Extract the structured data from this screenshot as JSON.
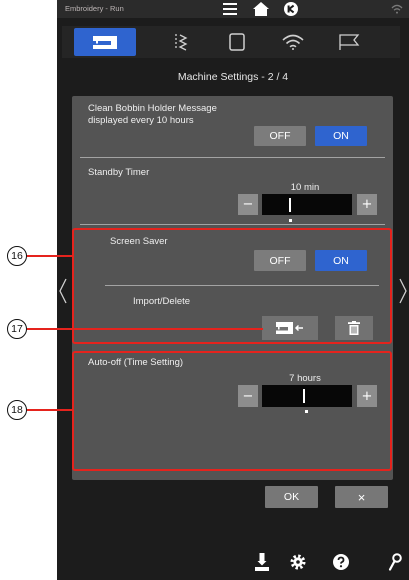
{
  "colors": {
    "accent_blue": "#2f64cf",
    "callout_red": "#e5231d",
    "screen_bg": "#1c1c1c",
    "panel_bg": "#545454",
    "button_gray": "#7c7c7c"
  },
  "status_bar": {
    "title": "Embroidery - Run",
    "icons": [
      "menu-icon",
      "home-icon",
      "circle-k-icon",
      "wifi-icon"
    ]
  },
  "tabs": [
    {
      "icon": "sewing-machine-icon",
      "selected": true
    },
    {
      "icon": "stitch-pattern-icon",
      "selected": false
    },
    {
      "icon": "embroidery-frame-icon",
      "selected": false
    },
    {
      "icon": "wifi-icon",
      "selected": false
    },
    {
      "icon": "flag-icon",
      "selected": false
    }
  ],
  "page_title": "Machine Settings - 2 / 4",
  "settings": {
    "bobbin_message": {
      "label_line1": "Clean Bobbin Holder Message",
      "label_line2": "displayed every 10 hours",
      "off_label": "OFF",
      "on_label": "ON",
      "on_selected": true
    },
    "standby_timer": {
      "label": "Standby Timer",
      "value": "10 min",
      "minus_label": "−",
      "plus_label": "+"
    },
    "screen_saver": {
      "label": "Screen Saver",
      "off_label": "OFF",
      "on_label": "ON",
      "on_selected": true
    },
    "import_delete": {
      "label": "Import/Delete",
      "import_icon": "import-machine-icon",
      "delete_icon": "trash-icon"
    },
    "auto_off": {
      "label": "Auto-off (Time Setting)",
      "value": "7 hours",
      "minus_label": "−",
      "plus_label": "+"
    }
  },
  "navigation": {
    "prev_icon": "chevron-left-icon",
    "next_icon": "chevron-right-icon"
  },
  "footer": {
    "ok_label": "OK",
    "cancel_label": "×"
  },
  "bottom_bar": {
    "icons": [
      "download-icon",
      "gear-icon",
      "help-icon",
      "key-icon"
    ]
  },
  "callouts": [
    {
      "number": "16"
    },
    {
      "number": "17"
    },
    {
      "number": "18"
    }
  ]
}
